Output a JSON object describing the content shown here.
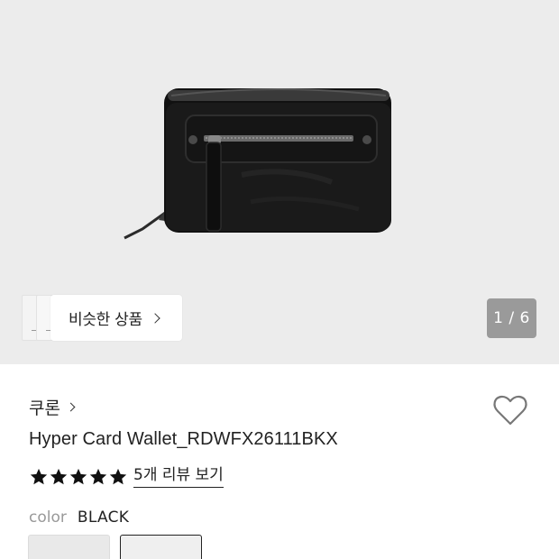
{
  "gallery": {
    "image_alt": "Hyper Card Wallet black product image",
    "similar_label": "비슷한 상품",
    "counter": "1 / 6"
  },
  "product": {
    "brand": "쿠론",
    "title": "Hyper Card Wallet_RDWFX26111BKX",
    "rating_stars": 5,
    "review_link": "5개 리뷰 보기",
    "color_label": "color",
    "color_value": "BLACK"
  },
  "icons": {
    "heart": "heart-outline-icon",
    "star": "star-filled-icon",
    "chevron": "chevron-right-icon"
  },
  "colors": {
    "gallery_bg": "#ececec",
    "counter_bg": "#9a9a9a",
    "text": "#222222",
    "muted": "#999999"
  }
}
